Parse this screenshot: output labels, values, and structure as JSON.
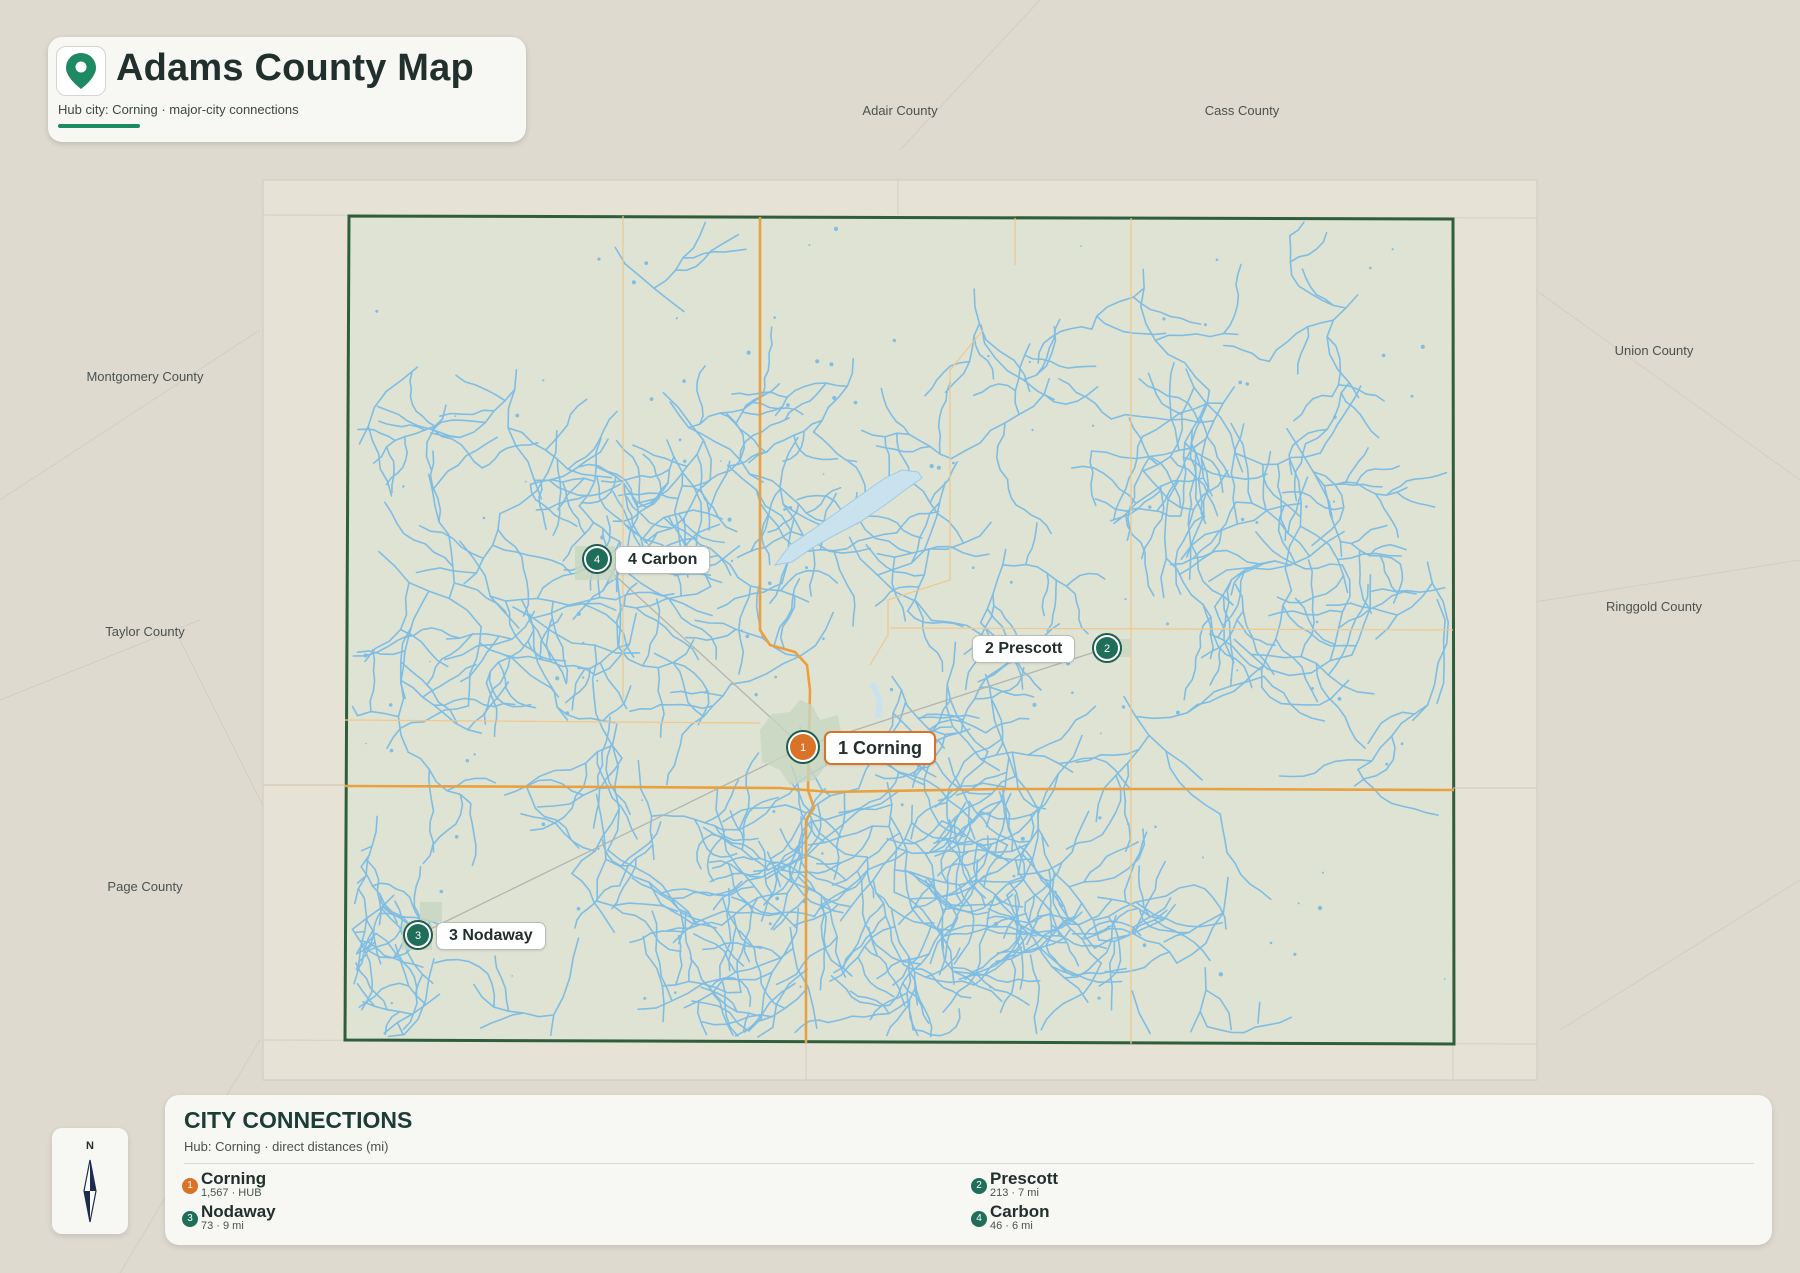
{
  "header": {
    "title": "Adams County Map",
    "subtitle": "Hub city: Corning · major-city connections",
    "pin_icon": "map-pin-icon"
  },
  "neighbors": [
    {
      "id": "adair",
      "name": "Adair County"
    },
    {
      "id": "cass",
      "name": "Cass County"
    },
    {
      "id": "montgomery",
      "name": "Montgomery County"
    },
    {
      "id": "union",
      "name": "Union County"
    },
    {
      "id": "taylor",
      "name": "Taylor County"
    },
    {
      "id": "ringgold",
      "name": "Ringgold County"
    },
    {
      "id": "page",
      "name": "Page County"
    }
  ],
  "cities": [
    {
      "rank": "1",
      "name": "Corning",
      "label": "1 Corning",
      "population": "1,567",
      "distance": "HUB",
      "detail": "1,567 · HUB",
      "hub": true
    },
    {
      "rank": "2",
      "name": "Prescott",
      "label": "2 Prescott",
      "population": "213",
      "distance": "7 mi",
      "detail": "213 · 7 mi",
      "hub": false
    },
    {
      "rank": "3",
      "name": "Nodaway",
      "label": "3 Nodaway",
      "population": "73",
      "distance": "9 mi",
      "detail": "73 · 9 mi",
      "hub": false
    },
    {
      "rank": "4",
      "name": "Carbon",
      "label": "4 Carbon",
      "population": "46",
      "distance": "6 mi",
      "detail": "46 · 6 mi",
      "hub": false
    }
  ],
  "legend": {
    "title": "CITY CONNECTIONS",
    "subtitle": "Hub: Corning · direct distances (mi)"
  },
  "compass": {
    "label": "N",
    "icon": "compass-needle-icon"
  },
  "colors": {
    "background": "#dedad0",
    "county_fill": "#dfe3d4",
    "county_border": "#2f5e3a",
    "roads": "#e8a040",
    "streams": "#7fbde3",
    "hub": "#d97328",
    "city": "#1e6e5a",
    "accent": "#1e8a63"
  }
}
